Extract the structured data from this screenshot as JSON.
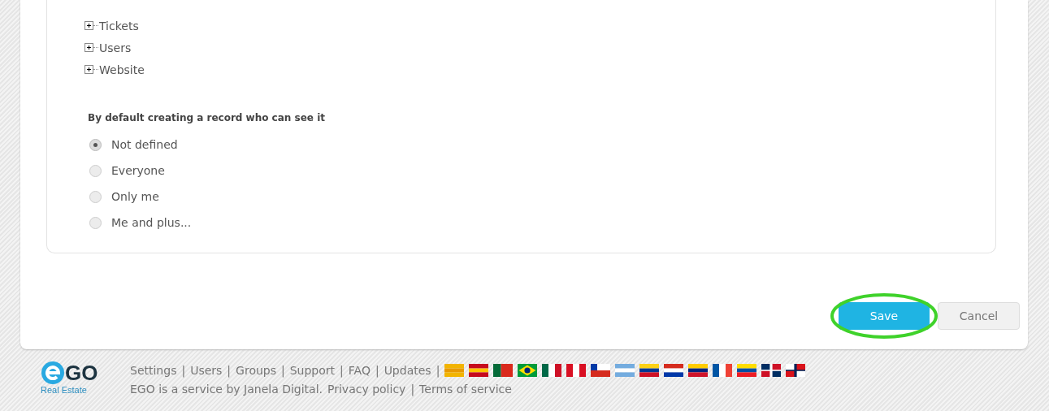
{
  "tree": [
    {
      "label": "Tickets",
      "expanded": false
    },
    {
      "label": "Users",
      "expanded": false
    },
    {
      "label": "Website",
      "expanded": false
    }
  ],
  "visibility": {
    "heading": "By default creating a record who can see it",
    "options": [
      {
        "label": "Not defined",
        "selected": true
      },
      {
        "label": "Everyone",
        "selected": false
      },
      {
        "label": "Only me",
        "selected": false
      },
      {
        "label": "Me and plus...",
        "selected": false
      }
    ]
  },
  "buttons": {
    "save": {
      "label": "Save",
      "highlighted": true
    },
    "cancel": {
      "label": "Cancel"
    }
  },
  "footer": {
    "logo": {
      "name": "GO",
      "subtitle": "Real Estate"
    },
    "separator": "|",
    "links": [
      "Settings",
      "Users",
      "Groups",
      "Support",
      "FAQ",
      "Updates"
    ],
    "credit": "EGO is a service by Janela Digital.",
    "legal": [
      "Privacy policy",
      "Terms of service"
    ]
  }
}
